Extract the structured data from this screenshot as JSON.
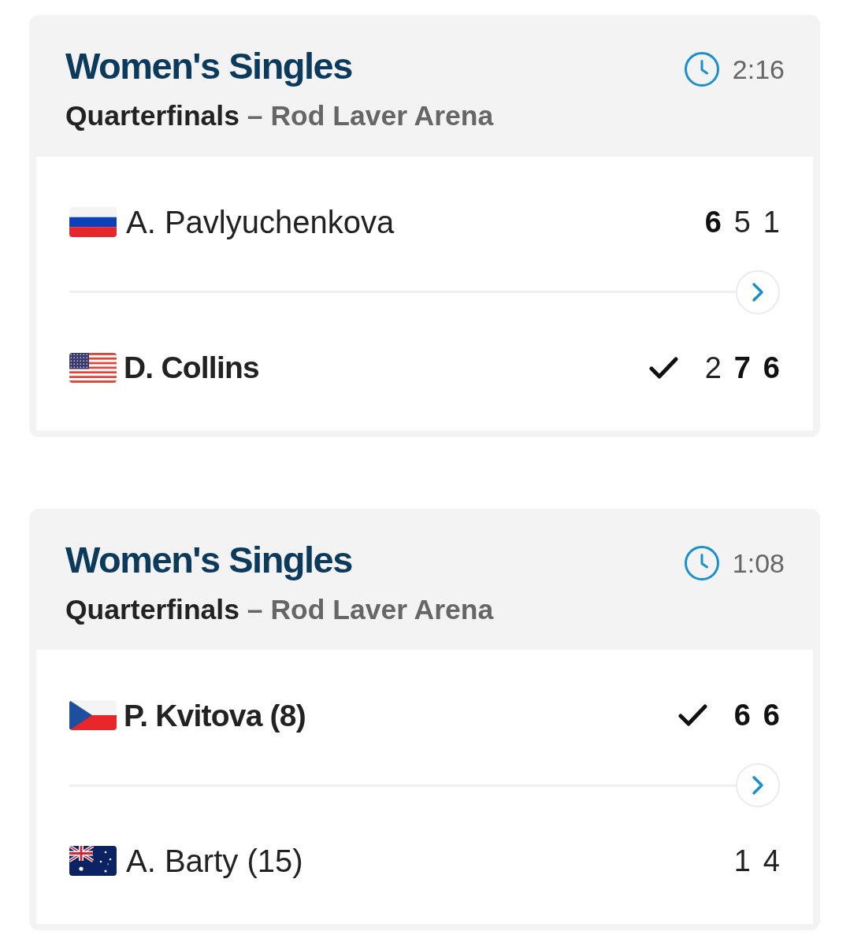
{
  "matches": [
    {
      "event": "Women's Singles",
      "round": "Quarterfinals",
      "separator": "–",
      "venue": "Rod Laver Arena",
      "duration": "2:16",
      "players": [
        {
          "flag": {
            "kind": "russia"
          },
          "name": "A. Pavlyuchenkova",
          "winner": false,
          "scores": [
            {
              "value": "6",
              "won": true
            },
            {
              "value": "5",
              "won": false
            },
            {
              "value": "1",
              "won": false
            }
          ]
        },
        {
          "flag": {
            "kind": "usa"
          },
          "name": "D. Collins",
          "winner": true,
          "scores": [
            {
              "value": "2",
              "won": false
            },
            {
              "value": "7",
              "won": true
            },
            {
              "value": "6",
              "won": true
            }
          ]
        }
      ]
    },
    {
      "event": "Women's Singles",
      "round": "Quarterfinals",
      "separator": "–",
      "venue": "Rod Laver Arena",
      "duration": "1:08",
      "players": [
        {
          "flag": {
            "kind": "czechia"
          },
          "name": "P. Kvitova (8)",
          "winner": true,
          "scores": [
            {
              "value": "6",
              "won": true
            },
            {
              "value": "6",
              "won": true
            }
          ]
        },
        {
          "flag": {
            "kind": "australia"
          },
          "name": "A. Barty (15)",
          "winner": false,
          "scores": [
            {
              "value": "1",
              "won": false
            },
            {
              "value": "4",
              "won": false
            }
          ]
        }
      ]
    }
  ]
}
